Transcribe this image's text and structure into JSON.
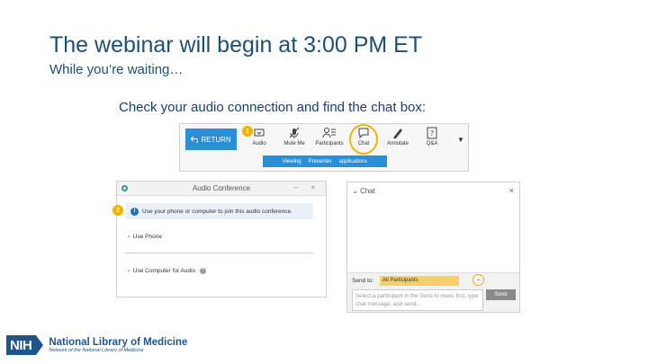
{
  "heading": {
    "title": "The webinar will begin at 3:00 PM ET",
    "subtitle": "While you’re waiting…",
    "instruction": "Check your audio connection and find the chat box:"
  },
  "toolbar": {
    "return_label": "RETURN",
    "badge": "1",
    "tools": [
      {
        "label": "Audio",
        "icon": "audio-icon"
      },
      {
        "label": "Mute Me",
        "icon": "microphone-icon"
      },
      {
        "label": "Participants",
        "icon": "participants-icon"
      },
      {
        "label": "Chat",
        "icon": "chat-icon"
      },
      {
        "label": "Annotate",
        "icon": "pencil-icon"
      },
      {
        "label": "Q&A",
        "icon": "question-icon"
      }
    ],
    "viewing_bar": [
      "Viewing",
      "Presenter",
      "applications"
    ]
  },
  "audio_panel": {
    "badge": "2",
    "title": "Audio Conference",
    "controls": "– ×",
    "info_text": "Use your phone or computer to join this audio conference.",
    "option_phone": "Use Phone",
    "option_computer": "Use Computer for Audio"
  },
  "chat_panel": {
    "title": "Chat",
    "close": "×",
    "send_to_label": "Send to:",
    "send_to_value": "All Participants",
    "input_placeholder": "Select a participant in the Send to menu first, type chat message, and send...",
    "send_label": "Send"
  },
  "logo": {
    "abbr": "NIH",
    "name": "National Library of Medicine",
    "tagline": "Network of the National Library of Medicine"
  },
  "colors": {
    "title": "#1f4e79",
    "accent_blue": "#2a8fd6",
    "highlight": "#f0b400",
    "nih_blue": "#20558a"
  }
}
